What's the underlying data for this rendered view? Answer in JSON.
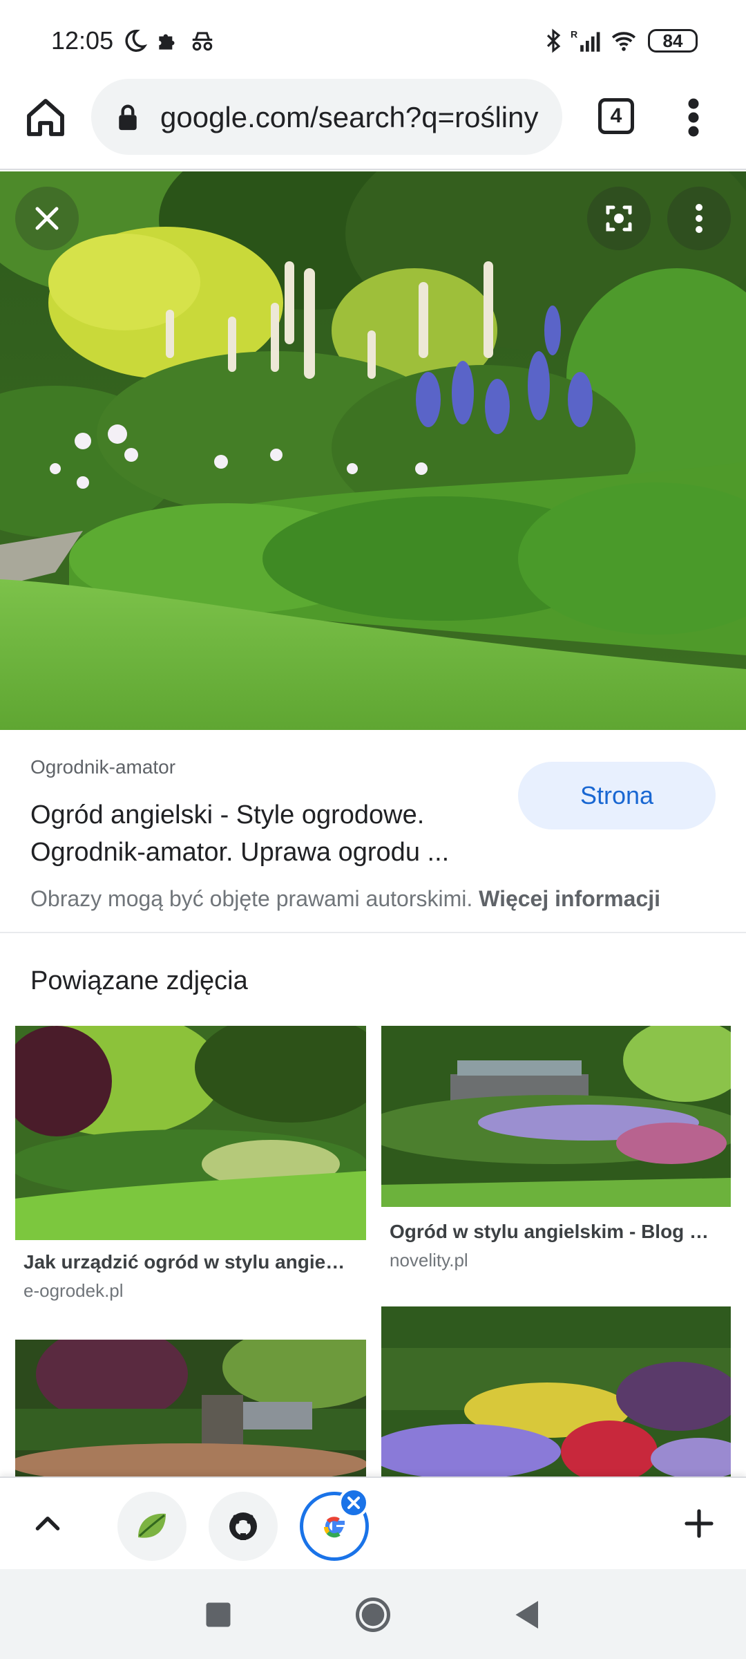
{
  "status_bar": {
    "time": "12:05",
    "battery": "84",
    "left_icons": [
      "moon-icon",
      "puzzle-icon",
      "incognito-icon"
    ],
    "right_icons": [
      "bluetooth-icon",
      "signal-icon",
      "wifi-icon"
    ]
  },
  "toolbar": {
    "url": "google.com/search?q=rośliny",
    "tab_count": "4"
  },
  "image_viewer": {
    "source": "Ogrodnik-amator",
    "title_line1": "Ogród angielski - Style ogrodowe.",
    "title_line2": "Ogrodnik-amator. Uprawa ogrodu ...",
    "visit_label": "Strona",
    "copyright_text": "Obrazy mogą być objęte prawami autorskimi.",
    "more_info_label": "Więcej informacji"
  },
  "related": {
    "heading": "Powiązane zdjęcia",
    "cards": [
      {
        "caption": "Jak urządzić ogród w stylu angie…",
        "domain": "e-ogrodek.pl"
      },
      {
        "caption": "Ogród w stylu angielskim - Blog …",
        "domain": "novelity.pl"
      }
    ]
  },
  "tabstrip": {
    "tabs": [
      "leaf-tab",
      "github-tab",
      "google-tab"
    ]
  },
  "colors": {
    "accent": "#1a73e8",
    "button_bg": "#e8f0fe",
    "button_text": "#1967d2"
  }
}
